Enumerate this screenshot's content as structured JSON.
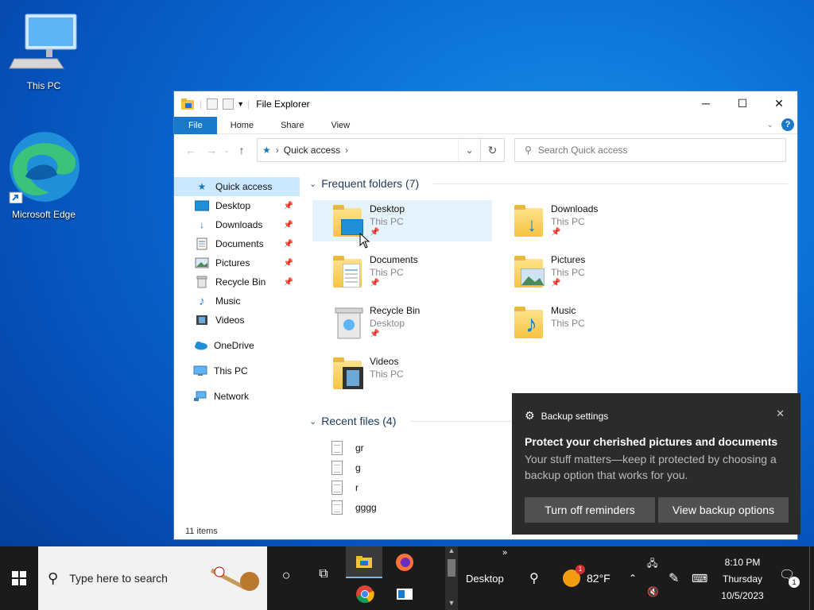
{
  "desktop": {
    "icons": [
      {
        "label": "This PC"
      },
      {
        "label": "Microsoft Edge"
      }
    ]
  },
  "window": {
    "title": "File Explorer",
    "ribbon_tabs": [
      "File",
      "Home",
      "Share",
      "View"
    ],
    "help_label": "?",
    "address": {
      "crumb": "Quick access"
    },
    "search": {
      "placeholder": "Search Quick access"
    }
  },
  "nav": {
    "items": [
      {
        "label": "Quick access",
        "icon": "star-icon"
      },
      {
        "label": "Desktop",
        "icon": "desktop-icon"
      },
      {
        "label": "Downloads",
        "icon": "downloads-icon"
      },
      {
        "label": "Documents",
        "icon": "documents-icon"
      },
      {
        "label": "Pictures",
        "icon": "pictures-icon"
      },
      {
        "label": "Recycle Bin",
        "icon": "recycle-bin-icon"
      },
      {
        "label": "Music",
        "icon": "music-icon"
      },
      {
        "label": "Videos",
        "icon": "videos-icon"
      },
      {
        "label": "OneDrive",
        "icon": "onedrive-icon"
      },
      {
        "label": "This PC",
        "icon": "this-pc-icon"
      },
      {
        "label": "Network",
        "icon": "network-icon"
      }
    ]
  },
  "frequent": {
    "header": "Frequent folders (7)",
    "folders": [
      {
        "name": "Desktop",
        "location": "This PC"
      },
      {
        "name": "Downloads",
        "location": "This PC"
      },
      {
        "name": "Documents",
        "location": "This PC"
      },
      {
        "name": "Pictures",
        "location": "This PC"
      },
      {
        "name": "Recycle Bin",
        "location": "Desktop"
      },
      {
        "name": "Music",
        "location": "This PC"
      },
      {
        "name": "Videos",
        "location": "This PC"
      }
    ]
  },
  "recent": {
    "header": "Recent files (4)",
    "files": [
      "gr",
      "g",
      "r",
      "gggg"
    ]
  },
  "status_bar": {
    "items": "11 items"
  },
  "toast": {
    "app": "Backup settings",
    "title": "Protect your cherished pictures and documents",
    "body": "Your stuff matters—keep it protected by choosing a backup option that works for you.",
    "button_left": "Turn off reminders",
    "button_right": "View backup options"
  },
  "taskbar": {
    "search_placeholder": "Type here to search",
    "toolbar_label": "Desktop",
    "temperature": "82°F",
    "weather_badge": "1",
    "time": "8:10 PM",
    "day": "Thursday",
    "date": "10/5/2023",
    "notification_count": "1"
  },
  "colors": {
    "accent": "#1979ca",
    "nav_selected": "#cce8ff",
    "toast_bg": "#2b2b2b",
    "taskbar_bg": "#1b1b1b"
  }
}
